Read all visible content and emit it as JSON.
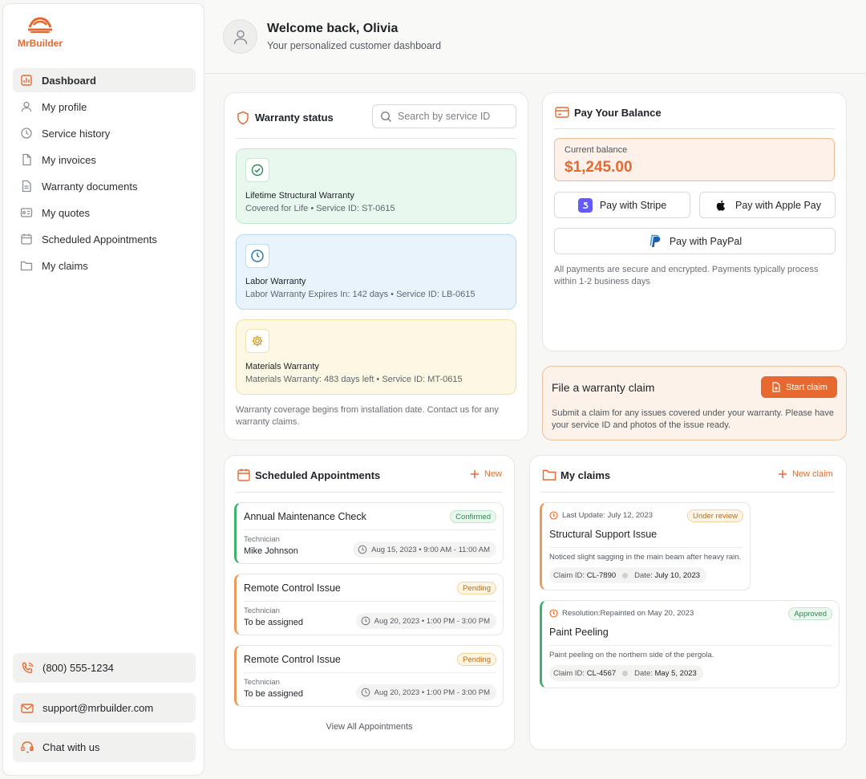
{
  "brand": {
    "name": "MrBuilder",
    "accent": "#e8692f"
  },
  "sidebar": {
    "items": [
      {
        "label": "Dashboard",
        "icon": "chart-icon"
      },
      {
        "label": "My profile",
        "icon": "user-icon"
      },
      {
        "label": "Service history",
        "icon": "history-icon"
      },
      {
        "label": "My invoices",
        "icon": "file-icon"
      },
      {
        "label": "Warranty documents",
        "icon": "document-icon"
      },
      {
        "label": "My quotes",
        "icon": "quote-icon"
      },
      {
        "label": "Scheduled Appointments",
        "icon": "calendar-icon"
      },
      {
        "label": "My claims",
        "icon": "folder-icon"
      }
    ],
    "contacts": [
      {
        "label": "(800) 555-1234",
        "icon": "phone-icon"
      },
      {
        "label": "support@mrbuilder.com",
        "icon": "mail-icon"
      },
      {
        "label": "Chat with us",
        "icon": "chat-icon"
      }
    ]
  },
  "header": {
    "welcome": "Welcome back, Olivia",
    "subtitle": "Your personalized customer dashboard"
  },
  "warranty": {
    "title": "Warranty status",
    "search_placeholder": "Search by service ID",
    "items": [
      {
        "name": "Lifetime Structural Warranty",
        "desc": "Covered for Life • Service ID: ST-0615",
        "color": "#e9f8ee"
      },
      {
        "name": "Labor Warranty",
        "desc": "Labor Warranty Expires In: 142 days • Service ID: LB-0615",
        "color": "#e8f3fc"
      },
      {
        "name": "Materials Warranty",
        "desc": "Materials Warranty: 483 days left • Service ID: MT-0615",
        "color": "#fdf8e4"
      }
    ],
    "note": "Warranty coverage begins from installation date. Contact us for any warranty claims."
  },
  "pay": {
    "title": "Pay Your Balance",
    "balance_label": "Current balance",
    "balance_value": "$1,245.00",
    "stripe_label": "Pay with Stripe",
    "apple_label": "Pay with Apple Pay",
    "paypal_label": "Pay with PayPal",
    "note": "All payments are secure and encrypted. Payments typically process within 1-2 business days"
  },
  "claim_banner": {
    "title": "File a warranty claim",
    "button": "Start claim",
    "text": "Submit a claim for any issues covered under your warranty. Please have your service ID and photos of the issue ready."
  },
  "appointments": {
    "title": "Scheduled Appointments",
    "new_label": "New",
    "view_all": "View All Appointments",
    "tech_label": "Technician",
    "items": [
      {
        "title": "Annual Maintenance Check",
        "status": "Confirmed",
        "technician": "Mike Johnson",
        "time": "Aug 15, 2023 • 9:00 AM - 11:00 AM",
        "accent": "#3fb36b"
      },
      {
        "title": "Remote Control Issue",
        "status": "Pending",
        "technician": "To be assigned",
        "time": "Aug 20, 2023 • 1:00 PM - 3:00 PM",
        "accent": "#ef9a5a"
      },
      {
        "title": "Remote Control Issue",
        "status": "Pending",
        "technician": "To be assigned",
        "time": "Aug 20, 2023 • 1:00 PM - 3:00 PM",
        "accent": "#ef9a5a"
      }
    ]
  },
  "claims": {
    "title": "My claims",
    "new_label": "New claim",
    "items": [
      {
        "top": "Last Update: July 12, 2023",
        "status": "Under review",
        "title": "Structural Support Issue",
        "desc": "Noticed slight sagging in the main beam after heavy rain.",
        "id_label": "Claim ID:",
        "id": "CL-7890",
        "date_label": "Date:",
        "date": "July 10, 2023",
        "accent": "#ef9a5a"
      },
      {
        "top": "Resolution:Repainted on May 20, 2023",
        "status": "Approved",
        "title": "Paint Peeling",
        "desc": "Paint peeling on the northern side of the pergola.",
        "id_label": "Claim ID:",
        "id": "CL-4567",
        "date_label": "Date:",
        "date": "May 5, 2023",
        "accent": "#3fb36b"
      }
    ]
  }
}
